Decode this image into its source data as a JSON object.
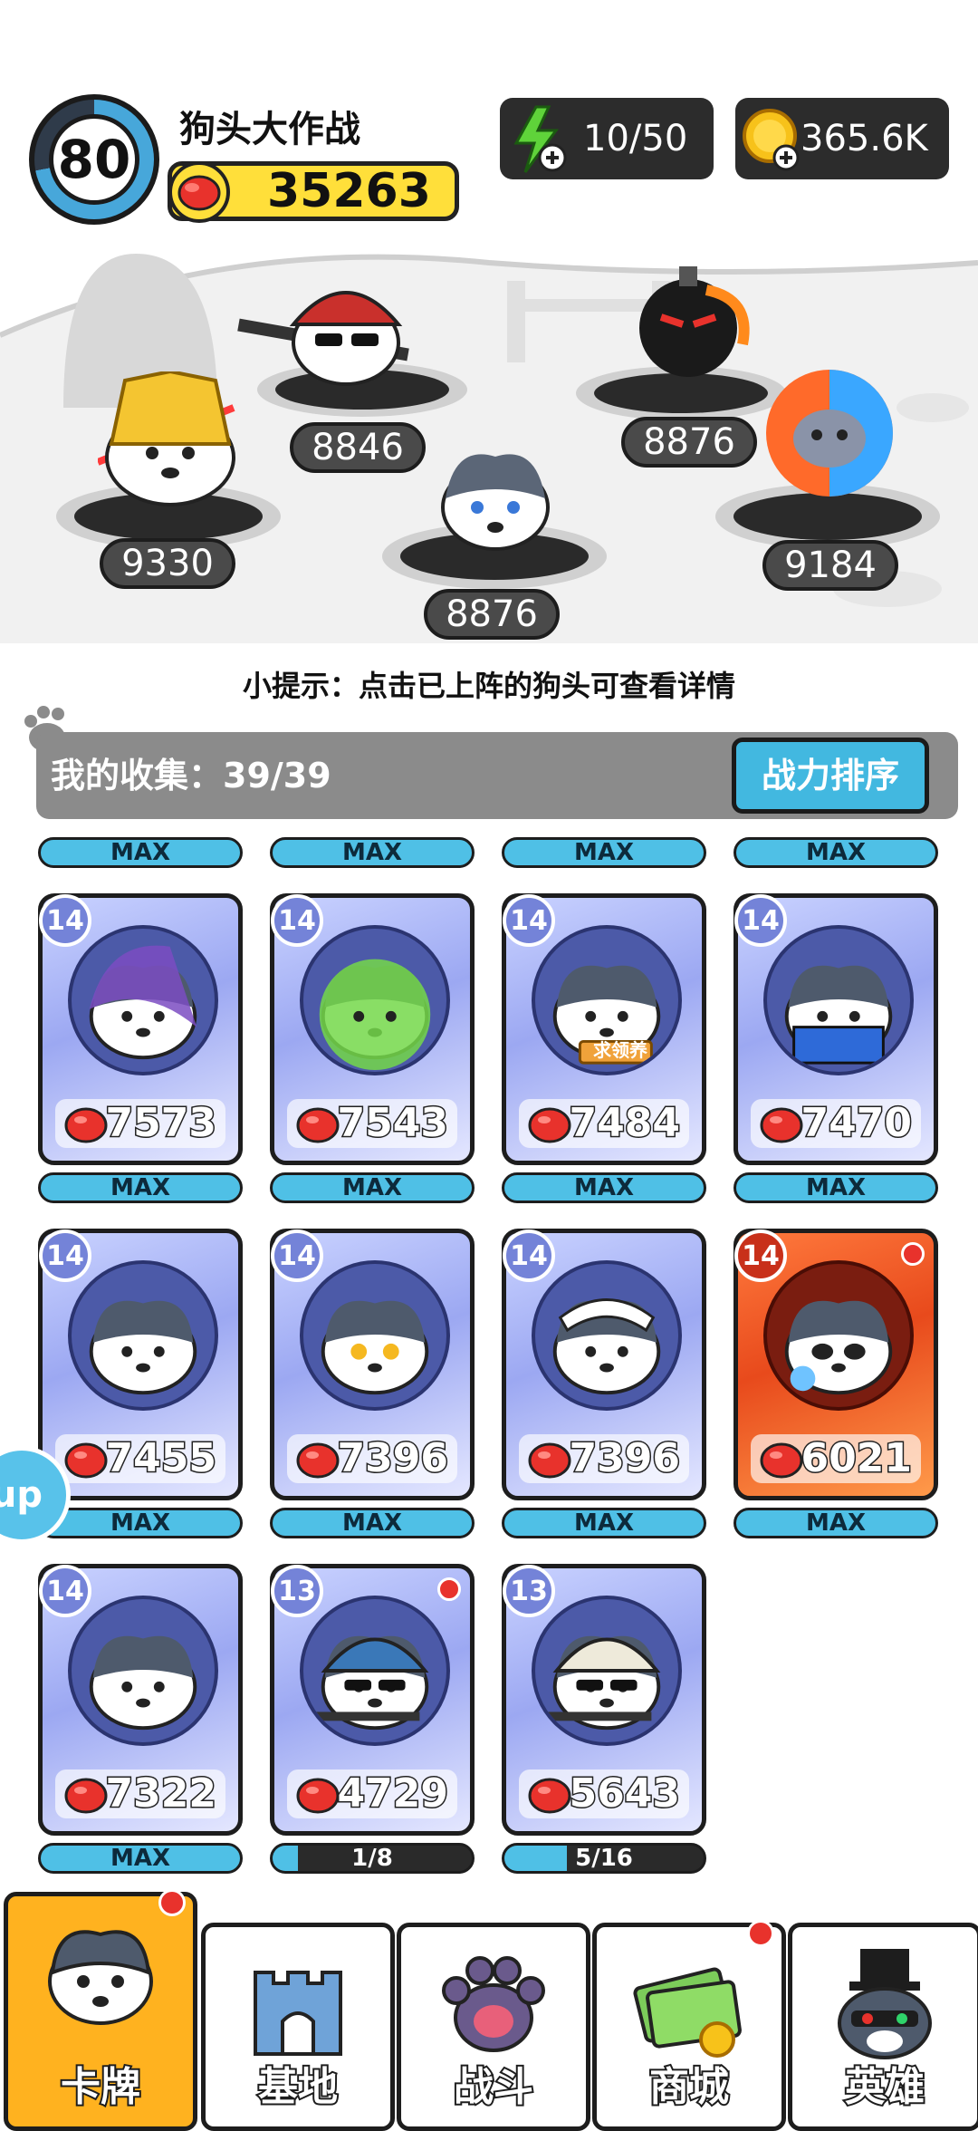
{
  "header": {
    "level": "80",
    "title": "狗头大作战",
    "total_power": "35263",
    "energy": "10/50",
    "coins": "365.6K"
  },
  "battlefield": {
    "scores": [
      "9330",
      "8846",
      "8876",
      "8876",
      "9184"
    ]
  },
  "hint": "小提示：点击已上阵的狗头可查看详情",
  "collection": {
    "label": "我的收集：39/39",
    "sort_button": "战力排序"
  },
  "top_tags": [
    "MAX",
    "MAX",
    "MAX",
    "MAX"
  ],
  "cards": [
    {
      "level": "14",
      "power": "7573",
      "tag": "MAX"
    },
    {
      "level": "14",
      "power": "7543",
      "tag": "MAX"
    },
    {
      "level": "14",
      "power": "7484",
      "tag": "MAX"
    },
    {
      "level": "14",
      "power": "7470",
      "tag": "MAX"
    },
    {
      "level": "14",
      "power": "7455",
      "tag": "MAX"
    },
    {
      "level": "14",
      "power": "7396",
      "tag": "MAX"
    },
    {
      "level": "14",
      "power": "7396",
      "tag": "MAX"
    },
    {
      "level": "14",
      "power": "6021",
      "tag": "MAX"
    },
    {
      "level": "14",
      "power": "7322",
      "tag": "MAX"
    },
    {
      "level": "13",
      "power": "4729",
      "tag": "1/8",
      "progress": 0.125
    },
    {
      "level": "13",
      "power": "5643",
      "tag": "5/16",
      "progress": 0.3125
    }
  ],
  "card_badges": {
    "plaque_text": "求领养"
  },
  "side_button": "up",
  "tabs": [
    {
      "label": "卡牌"
    },
    {
      "label": "基地"
    },
    {
      "label": "战斗"
    },
    {
      "label": "商城"
    },
    {
      "label": "英雄"
    }
  ],
  "colors": {
    "accent_blue": "#4fc0e6",
    "power_yellow": "#ffdf3a",
    "active_tab": "#ffb21f",
    "notify_red": "#e8322c"
  }
}
